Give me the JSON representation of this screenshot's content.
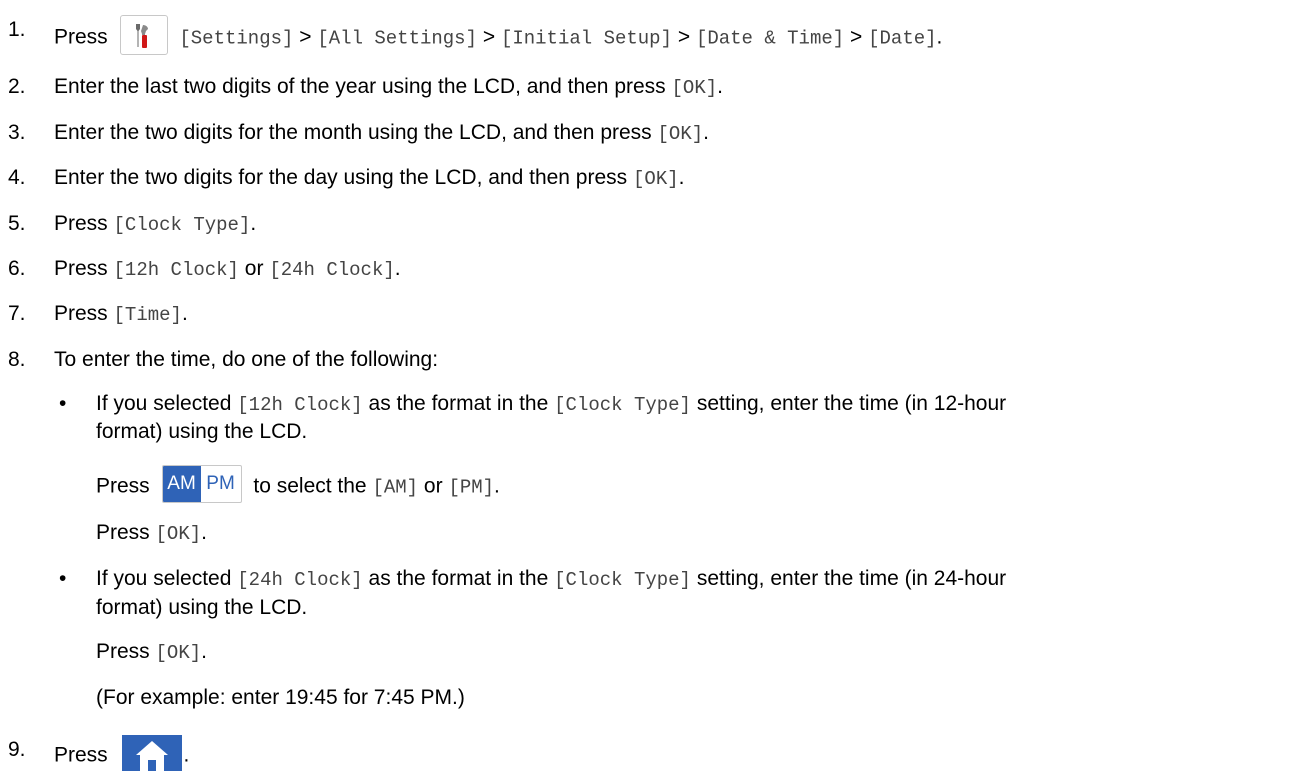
{
  "steps": [
    {
      "num": "1.",
      "press": "Press",
      "parts": [
        "[Settings]",
        ">",
        "[All Settings]",
        ">",
        "[Initial Setup]",
        ">",
        "[Date & Time]",
        ">",
        "[Date]",
        "."
      ]
    },
    {
      "num": "2.",
      "text": "Enter the last two digits of the year using the LCD, and then press",
      "code": "[OK]",
      "end": "."
    },
    {
      "num": "3.",
      "text": "Enter the two digits for the month using the LCD, and then press",
      "code": "[OK]",
      "end": "."
    },
    {
      "num": "4.",
      "text": "Enter the two digits for the day using the LCD, and then press",
      "code": "[OK]",
      "end": "."
    },
    {
      "num": "5.",
      "text": "Press",
      "code": "[Clock Type]",
      "end": "."
    },
    {
      "num": "6.",
      "text": "Press",
      "code": "[12h Clock]",
      "mid": "or",
      "code2": "[24h Clock]",
      "end": "."
    },
    {
      "num": "7.",
      "text": "Press",
      "code": "[Time]",
      "end": "."
    },
    {
      "num": "8.",
      "text": "To enter the time, do one of the following:"
    },
    {
      "num": "9.",
      "text": "Press",
      "end": "."
    }
  ],
  "bullets": [
    {
      "mark": "•",
      "a": "If you selected",
      "code": "[12h Clock]",
      "b": "as the format in the",
      "code2": "[Clock Type]",
      "c": "setting, enter the time (in 12-hour",
      "line2": "format) using the LCD.",
      "ampm_pre": "Press",
      "ampm_post": "to select the",
      "am_code": "[AM]",
      "or": "or",
      "pm_code": "[PM]",
      "dot": ".",
      "press_ok": "Press",
      "ok": "[OK]"
    },
    {
      "mark": "•",
      "a": "If you selected",
      "code": "[24h Clock]",
      "b": "as the format in the",
      "code2": "[Clock Type]",
      "c": "setting, enter the time (in 24-hour",
      "line2": "format) using the LCD.",
      "press_ok": "Press",
      "ok": "[OK]",
      "example": "(For example: enter 19:45 for 7:45 PM.)"
    }
  ],
  "icons": {
    "settings": "settings-tools-icon",
    "am_label": "AM",
    "pm_label": "PM",
    "home": "home-icon",
    "accent": "#2f63b7"
  }
}
